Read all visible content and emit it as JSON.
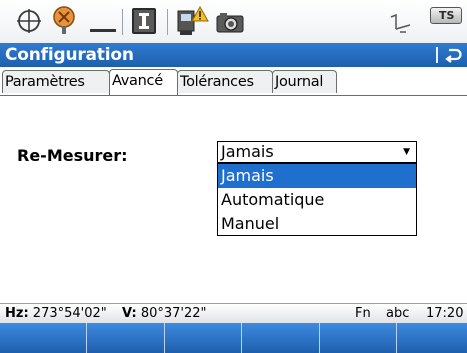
{
  "topbar": {
    "icons": [
      "target-crosshair-icon",
      "prism-reflector-icon",
      "level-bubble-icon",
      "instrument-i-icon",
      "measurement-warning-icon",
      "camera-icon",
      "tilt-sensor-icon",
      "ts-battery-icon"
    ],
    "ts_label": "TS"
  },
  "window": {
    "title": "Configuration",
    "back_icon": "return-arrow-icon"
  },
  "tabs": [
    {
      "label": "Paramètres",
      "active": false
    },
    {
      "label": "Avancé",
      "active": true
    },
    {
      "label": "Tolérances",
      "active": false
    },
    {
      "label": "Journal",
      "active": false
    }
  ],
  "form": {
    "remesurer_label": "Re-Mesurer:",
    "remesurer_value": "Jamais",
    "options": [
      "Jamais",
      "Automatique",
      "Manuel"
    ],
    "selected_index": 0
  },
  "status": {
    "hz_label": "Hz:",
    "hz_value": "273°54'02\"",
    "v_label": "V:",
    "v_value": "80°37'22\"",
    "fn": "Fn",
    "input_mode": "abc",
    "time": "17:20"
  },
  "colors": {
    "accent": "#1f6fcf",
    "titlebar": "#2566b8"
  }
}
